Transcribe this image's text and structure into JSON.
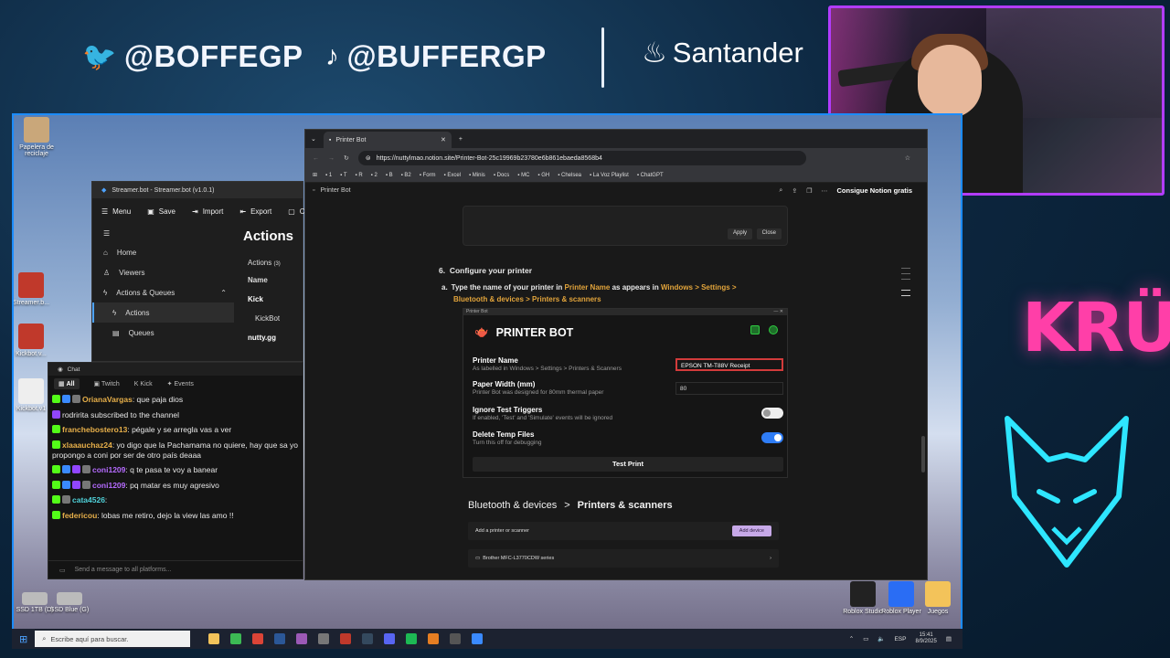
{
  "overlay": {
    "twitter_handle": "@BOFFEGP",
    "tiktok_handle": "@BUFFERGP",
    "sponsor": "Santander",
    "logo_text": "KRÜ"
  },
  "desktop_icons": {
    "recycle": "Papelera de reciclaje",
    "sb1": "Streamer.b...",
    "sb2": "Kickbot.v...",
    "sb3": "Kickbot.v1",
    "ssd1": "SSD 1TB (D)",
    "ssd2": "SSD Blue (G)",
    "roblox_studio": "Roblox Studio",
    "roblox_player": "Roblox Player",
    "juegos": "Juegos"
  },
  "streamerbot": {
    "title": "Streamer.bot - Streamer.bot (v1.0.1)",
    "menu": [
      "Menu",
      "Save",
      "Import",
      "Export",
      "C"
    ],
    "nav": [
      "Home",
      "Viewers",
      "Actions & Queues",
      "Actions",
      "Queues"
    ],
    "heading": "Actions",
    "actions_label": "Actions",
    "actions_count": "(3)",
    "col_name": "Name",
    "rows": [
      "Kick",
      "KickBot",
      "nutty.gg"
    ]
  },
  "chat": {
    "window_title": "Chat",
    "tabs": [
      "All",
      "Twitch",
      "Kick",
      "Events"
    ],
    "messages": [
      {
        "user": "OrianaVargas",
        "text": ": que paja dios",
        "color": "#e8b04a"
      },
      {
        "user": "",
        "text": "rodririta subscribed to the channel",
        "color": "#e8e8e8"
      },
      {
        "user": "franchebostero13",
        "text": ": pégale y se arregla vas a ver",
        "color": "#e8b04a"
      },
      {
        "user": "xlaaauchaz24",
        "text": ": yo digo que la Pachamama no quiere, hay que sa yo propongo a coni por ser de otro país deaaa",
        "color": "#e8b04a"
      },
      {
        "user": "coni1209",
        "text": ": q te pasa te voy a banear",
        "color": "#b56bff"
      },
      {
        "user": "coni1209",
        "text": ": pq matar es muy agresivo",
        "color": "#b56bff"
      },
      {
        "user": "cata4526",
        "text": ":",
        "color": "#4fd1d9"
      },
      {
        "user": "federicou",
        "text": ": lobas me retiro, dejo la view las amo !!",
        "color": "#e8b04a"
      }
    ],
    "input_placeholder": "Send a message to all platforms..."
  },
  "browser": {
    "tab_title": "Printer Bot",
    "url": "https://nuttylmao.notion.site/Printer-Bot-25c19969b23780e6b861ebaeda8568b4",
    "bookmarks": [
      "1",
      "T",
      "R",
      "2",
      "B",
      "B2",
      "Form",
      "Excel",
      "Minis",
      "Docs",
      "MC",
      "GH",
      "Chelsea",
      "La Voz Playlist",
      "ChatGPT"
    ],
    "notion_page": "Printer Bot",
    "notion_cta": "Consigue Notion gratis"
  },
  "notion": {
    "apply": "Apply",
    "close": "Close",
    "step_number": "6.",
    "step_title": "Configure your printer",
    "substep_letter": "a.",
    "sub_part1": "Type the name of your printer in ",
    "sub_hl1": "Printer Name",
    "sub_part2": " as appears in ",
    "sub_hl2": "Windows > Settings > Bluetooth & devices > Printers & scanners",
    "pb_window": "Printer Bot",
    "pb_title": "PRINTER BOT",
    "printer_name_label": "Printer Name",
    "printer_name_hint": "As labelled in Windows > Settings > Printers & Scanners",
    "printer_name_value": "EPSON TM-T88V Receipt",
    "paper_width_label": "Paper Width (mm)",
    "paper_width_hint": "Printer Bot was designed for 80mm thermal paper",
    "paper_width_value": "80",
    "ignore_label": "Ignore Test Triggers",
    "ignore_hint": "If enabled, 'Test' and 'Simulate' events will be ignored",
    "delete_label": "Delete Temp Files",
    "delete_hint": "Turn this off for debugging",
    "test_print": "Test Print",
    "bt_crumb1": "Bluetooth & devices",
    "bt_sep": ">",
    "bt_crumb2": "Printers & scanners",
    "add_printer": "Add a printer or scanner",
    "add_device": "Add device",
    "brother": "Brother MFC-L3770CDW series"
  },
  "taskbar": {
    "search": "Escribe aquí para buscar.",
    "lang": "ESP",
    "time": "15:41",
    "date": "8/9/2025"
  },
  "colors": {
    "accent_border": "#1b8cff",
    "cam_border": "#b23cff",
    "highlight": "#e2a43b",
    "error_red": "#d23b3b"
  }
}
